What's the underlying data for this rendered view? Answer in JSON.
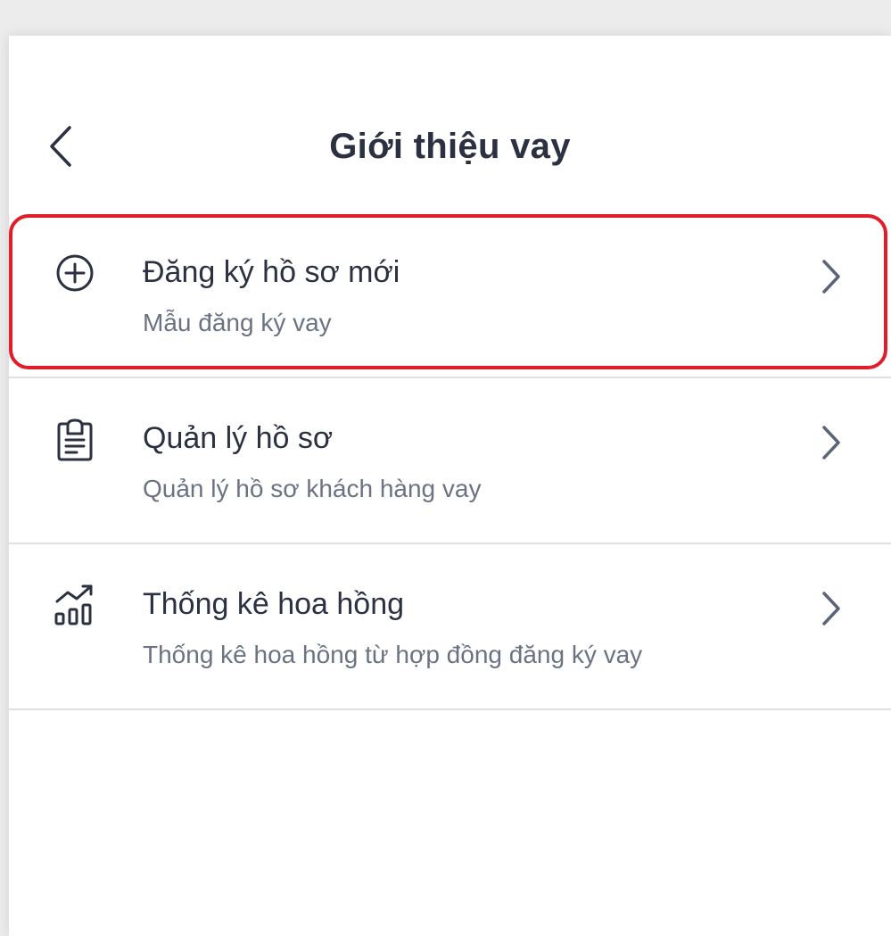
{
  "header": {
    "title": "Giới thiệu vay",
    "back_icon": "chevron-left-icon"
  },
  "menu": {
    "items": [
      {
        "title": "Đăng ký hồ sơ mới",
        "subtitle": "Mẫu đăng ký vay",
        "icon": "plus-circle-icon",
        "highlighted": true
      },
      {
        "title": "Quản lý hồ sơ",
        "subtitle": "Quản lý hồ sơ khách hàng vay",
        "icon": "clipboard-icon",
        "highlighted": false
      },
      {
        "title": "Thống kê hoa hồng",
        "subtitle": "Thống kê hoa hồng từ hợp đồng đăng ký vay",
        "icon": "bar-chart-trend-icon",
        "highlighted": false
      }
    ]
  },
  "colors": {
    "text_primary": "#2b3140",
    "text_secondary": "#6b7383",
    "chevron": "#5c6478",
    "divider": "#dde0e6",
    "highlight_border": "#e11d2a"
  }
}
